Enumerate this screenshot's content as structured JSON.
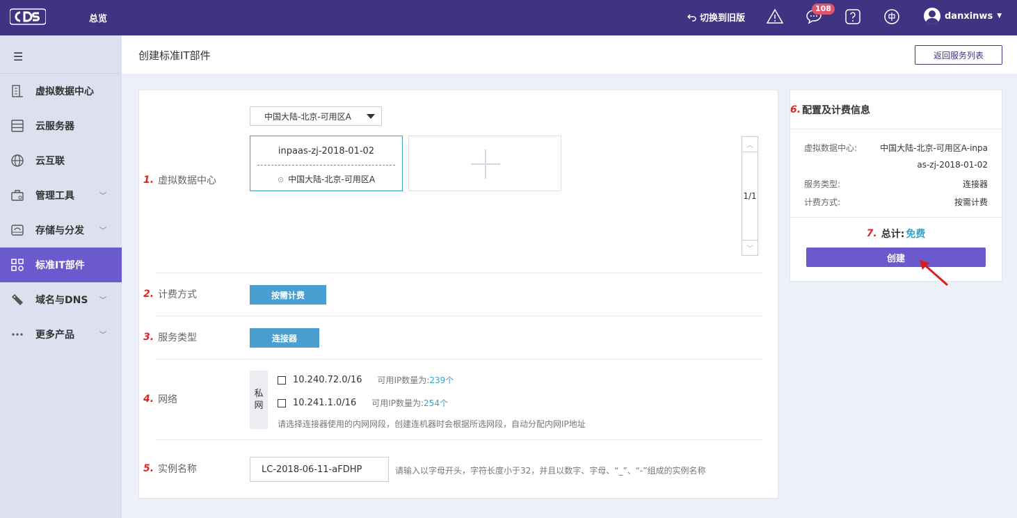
{
  "topbar": {
    "logo_icon": "cds-logo",
    "overview": "总览",
    "switch_old": "切换到旧版",
    "switch_icon": "undo-icon",
    "alert_icon": "warning-icon",
    "message_icon": "chat-icon",
    "message_badge": "108",
    "help_icon": "question-icon",
    "lang_icon": "chinese-icon",
    "user_name": "danxinws",
    "user_icon": "user-icon"
  },
  "sidebar": {
    "menu_icon": "hamburger-icon",
    "items": [
      {
        "label": "虚拟数据中心",
        "icon": "building-icon",
        "has_chevron": false,
        "active": false
      },
      {
        "label": "云服务器",
        "icon": "server-icon",
        "has_chevron": false,
        "active": false
      },
      {
        "label": "云互联",
        "icon": "globe-icon",
        "has_chevron": false,
        "active": false
      },
      {
        "label": "管理工具",
        "icon": "toolbox-icon",
        "has_chevron": true,
        "active": false
      },
      {
        "label": "存储与分发",
        "icon": "storage-icon",
        "has_chevron": true,
        "active": false
      },
      {
        "label": "标准IT部件",
        "icon": "grid-icon",
        "has_chevron": false,
        "active": true
      },
      {
        "label": "域名与DNS",
        "icon": "tag-icon",
        "has_chevron": true,
        "active": false
      },
      {
        "label": "更多产品",
        "icon": "more-icon",
        "has_chevron": true,
        "active": false
      }
    ]
  },
  "header": {
    "title": "创建标准IT部件",
    "return_button": "返回服务列表"
  },
  "form": {
    "vdc": {
      "number": "1.",
      "label": "虚拟数据中心",
      "region_selected": "中国大陆-北京-可用区A",
      "card_name": "inpaas-zj-2018-01-02",
      "card_location": "中国大陆-北京-可用区A",
      "pager": "1/1"
    },
    "billing": {
      "number": "2.",
      "label": "计费方式",
      "button": "按需计费"
    },
    "service_type": {
      "number": "3.",
      "label": "服务类型",
      "button": "连接器"
    },
    "network": {
      "number": "4.",
      "label": "网络",
      "tag_line1": "私",
      "tag_line2": "网",
      "ip_label": "可用IP数量为:",
      "options": [
        {
          "cidr": "10.240.72.0/16",
          "count": "239个"
        },
        {
          "cidr": "10.241.1.0/16",
          "count": "254个"
        }
      ],
      "hint": "请选择连接器使用的内网网段，创建连机器时会根据所选网段，自动分配内网IP地址"
    },
    "instance": {
      "number": "5.",
      "label": "实例名称",
      "value": "LC-2018-06-11-aFDHP",
      "hint": "请输入以字母开头，字符长度小于32，并且以数字、字母、“_”、“-”组成的实例名称"
    }
  },
  "summary": {
    "number": "6.",
    "title": "配置及计费信息",
    "vdc_key": "虚拟数据中心:",
    "vdc_value_line1": "中国大陆-北京-可用区A-inpa",
    "vdc_value_line2": "as-zj-2018-01-02",
    "type_key": "服务类型:",
    "type_value": "连接器",
    "billing_key": "计费方式:",
    "billing_value": "按需计费",
    "total_number": "7.",
    "total_label": "总计:",
    "total_value": "免费",
    "create_button": "创建"
  }
}
